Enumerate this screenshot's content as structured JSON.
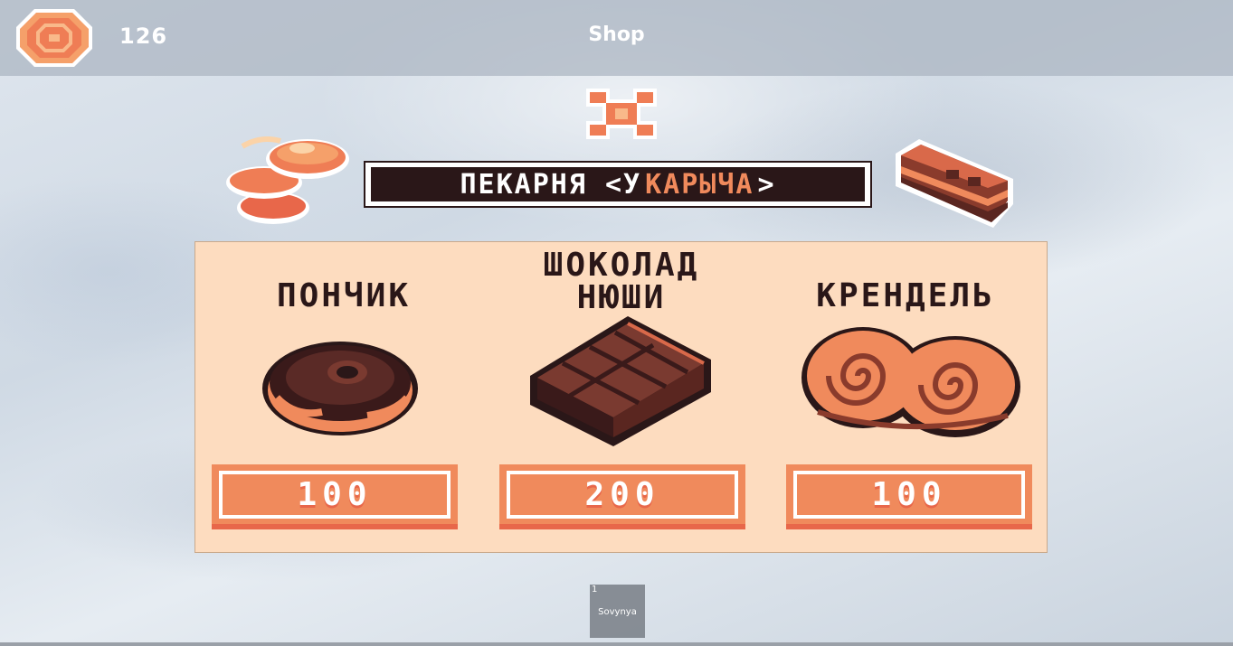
{
  "hud": {
    "coin_icon": "coin-icon",
    "coin_count": "126",
    "shop_title": "Shop",
    "close_icon": "close-x-icon"
  },
  "bakery": {
    "title_part1": "ПЕКАРНЯ <У",
    "title_part2": "КАРЫЧА",
    "title_part3": ">",
    "left_deco_icon": "pancakes-icon",
    "right_deco_icon": "cake-slice-icon"
  },
  "items": [
    {
      "name": "ПОНЧИК",
      "icon": "donut-icon",
      "price": "100"
    },
    {
      "name": "ШОКОЛАД НЮШИ",
      "icon": "chocolate-bar-icon",
      "price": "200"
    },
    {
      "name": "КРЕНДЕЛЬ",
      "icon": "pretzel-icon",
      "price": "100"
    }
  ],
  "hotbar": {
    "slot_number": "1",
    "slot_label": "Sovynya"
  },
  "colors": {
    "accent": "#f08a5c",
    "accent_dark": "#e8674a",
    "panel_bg": "#fddcbf",
    "dark_brown": "#2a1718"
  }
}
